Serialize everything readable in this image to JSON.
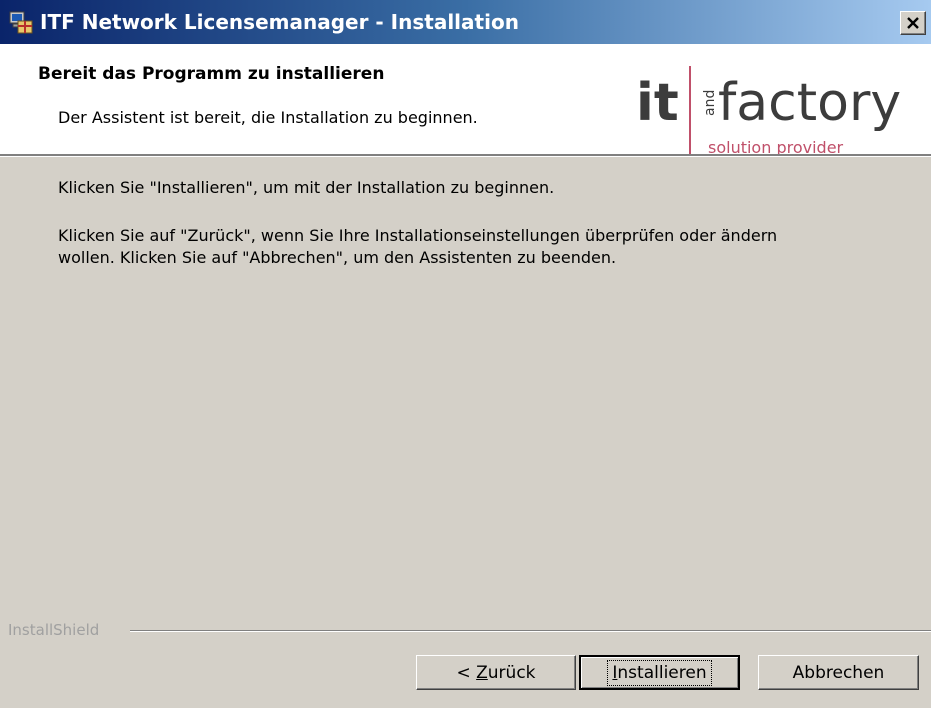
{
  "window": {
    "title": "ITF Network Licensemanager - Installation"
  },
  "header": {
    "title": "Bereit das Programm zu installieren",
    "subtitle": "Der Assistent ist bereit, die Installation zu beginnen.",
    "logo": {
      "it_text": "it",
      "and_text": "and",
      "factory_text": "factory",
      "tagline": "solution provider",
      "color_dark": "#3c3c3c",
      "color_accent": "#c0506a"
    }
  },
  "body": {
    "line1": "Klicken Sie \"Installieren\", um mit der Installation zu beginnen.",
    "line2": "Klicken Sie auf \"Zurück\", wenn Sie Ihre Installationseinstellungen überprüfen oder ändern",
    "line3": "wollen. Klicken Sie auf \"Abbrechen\", um den Assistenten zu beenden."
  },
  "footer": {
    "brand": "InstallShield"
  },
  "buttons": {
    "back_prefix": "< ",
    "back_accel": "Z",
    "back_rest": "urück",
    "install_accel": "I",
    "install_rest": "nstallieren",
    "cancel": "Abbrechen"
  },
  "icons": {
    "app": "installer-computer-icon",
    "close": "close-icon"
  }
}
